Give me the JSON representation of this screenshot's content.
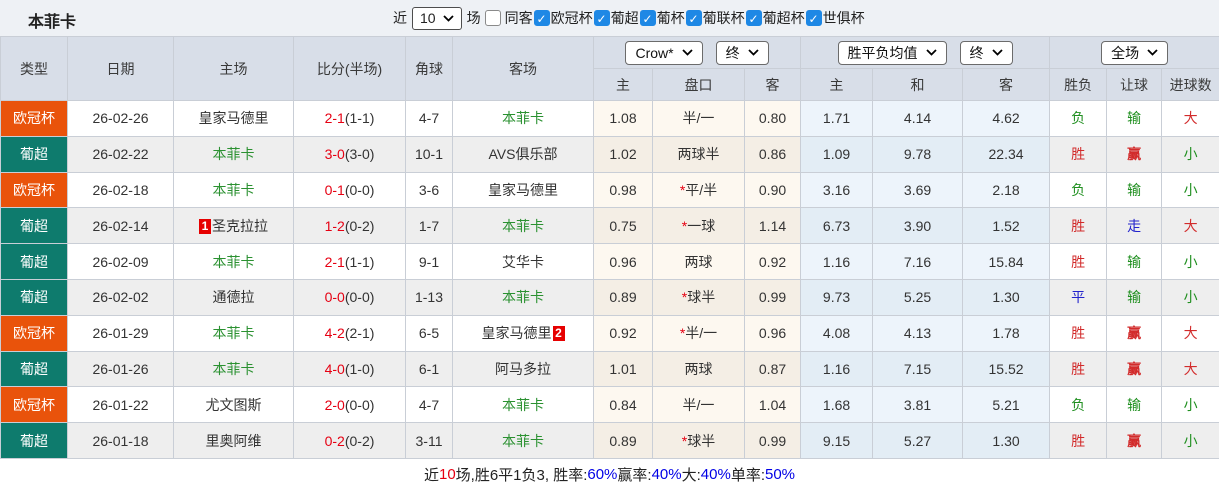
{
  "page": {
    "title": "本菲卡"
  },
  "filters": {
    "recent_prefix": "近",
    "recent_value": "10",
    "recent_suffix": "场",
    "same_opponent_label": "同客",
    "same_opponent_checked": false,
    "leagues": [
      {
        "label": "欧冠杯",
        "checked": true
      },
      {
        "label": "葡超",
        "checked": true
      },
      {
        "label": "葡杯",
        "checked": true
      },
      {
        "label": "葡联杯",
        "checked": true
      },
      {
        "label": "葡超杯",
        "checked": true
      },
      {
        "label": "世俱杯",
        "checked": true
      }
    ]
  },
  "table": {
    "columns": [
      "类型",
      "日期",
      "主场",
      "比分(半场)",
      "角球",
      "客场"
    ],
    "selects": {
      "bookmaker": "Crow*",
      "bookmaker_time": "终",
      "avg": "胜平负均值",
      "avg_time": "终",
      "scope": "全场"
    },
    "sub_headers": [
      "主",
      "盘口",
      "客",
      "主",
      "和",
      "客",
      "胜负",
      "让球",
      "进球数"
    ],
    "rows": [
      {
        "league": "欧冠杯",
        "league_color": "orange",
        "date": "26-02-26",
        "home": "皇家马德里",
        "home_green": false,
        "home_badge": "",
        "score": "2-1",
        "half": "(1-1)",
        "corners": "4-7",
        "away": "本菲卡",
        "away_green": true,
        "away_badge": "",
        "asia_home": "1.08",
        "handicap": "半/一",
        "handicap_star": false,
        "asia_away": "0.80",
        "avg_home": "1.71",
        "avg_draw": "4.14",
        "avg_away": "4.62",
        "outcome": "负",
        "outcome_color": "green",
        "let_result": "输",
        "let_color": "green",
        "goal_result": "大",
        "goal_color": "red"
      },
      {
        "league": "葡超",
        "league_color": "teal",
        "date": "26-02-22",
        "home": "本菲卡",
        "home_green": true,
        "home_badge": "",
        "score": "3-0",
        "half": "(3-0)",
        "corners": "10-1",
        "away": "AVS俱乐部",
        "away_green": false,
        "away_badge": "",
        "asia_home": "1.02",
        "handicap": "两球半",
        "handicap_star": false,
        "asia_away": "0.86",
        "avg_home": "1.09",
        "avg_draw": "9.78",
        "avg_away": "22.34",
        "outcome": "胜",
        "outcome_color": "red",
        "let_result": "赢",
        "let_color": "red",
        "goal_result": "小",
        "goal_color": "green"
      },
      {
        "league": "欧冠杯",
        "league_color": "orange",
        "date": "26-02-18",
        "home": "本菲卡",
        "home_green": true,
        "home_badge": "",
        "score": "0-1",
        "half": "(0-0)",
        "corners": "3-6",
        "away": "皇家马德里",
        "away_green": false,
        "away_badge": "",
        "asia_home": "0.98",
        "handicap": "平/半",
        "handicap_star": true,
        "asia_away": "0.90",
        "avg_home": "3.16",
        "avg_draw": "3.69",
        "avg_away": "2.18",
        "outcome": "负",
        "outcome_color": "green",
        "let_result": "输",
        "let_color": "green",
        "goal_result": "小",
        "goal_color": "green"
      },
      {
        "league": "葡超",
        "league_color": "teal",
        "date": "26-02-14",
        "home": "圣克拉拉",
        "home_green": false,
        "home_badge": "1",
        "score": "1-2",
        "half": "(0-2)",
        "corners": "1-7",
        "away": "本菲卡",
        "away_green": true,
        "away_badge": "",
        "asia_home": "0.75",
        "handicap": "一球",
        "handicap_star": true,
        "asia_away": "1.14",
        "avg_home": "6.73",
        "avg_draw": "3.90",
        "avg_away": "1.52",
        "outcome": "胜",
        "outcome_color": "red",
        "let_result": "走",
        "let_color": "blue",
        "goal_result": "大",
        "goal_color": "red"
      },
      {
        "league": "葡超",
        "league_color": "teal",
        "date": "26-02-09",
        "home": "本菲卡",
        "home_green": true,
        "home_badge": "",
        "score": "2-1",
        "half": "(1-1)",
        "corners": "9-1",
        "away": "艾华卡",
        "away_green": false,
        "away_badge": "",
        "asia_home": "0.96",
        "handicap": "两球",
        "handicap_star": false,
        "asia_away": "0.92",
        "avg_home": "1.16",
        "avg_draw": "7.16",
        "avg_away": "15.84",
        "outcome": "胜",
        "outcome_color": "red",
        "let_result": "输",
        "let_color": "green",
        "goal_result": "小",
        "goal_color": "green"
      },
      {
        "league": "葡超",
        "league_color": "teal",
        "date": "26-02-02",
        "home": "通德拉",
        "home_green": false,
        "home_badge": "",
        "score": "0-0",
        "half": "(0-0)",
        "corners": "1-13",
        "away": "本菲卡",
        "away_green": true,
        "away_badge": "",
        "asia_home": "0.89",
        "handicap": "球半",
        "handicap_star": true,
        "asia_away": "0.99",
        "avg_home": "9.73",
        "avg_draw": "5.25",
        "avg_away": "1.30",
        "outcome": "平",
        "outcome_color": "blue",
        "let_result": "输",
        "let_color": "green",
        "goal_result": "小",
        "goal_color": "green"
      },
      {
        "league": "欧冠杯",
        "league_color": "orange",
        "date": "26-01-29",
        "home": "本菲卡",
        "home_green": true,
        "home_badge": "",
        "score": "4-2",
        "half": "(2-1)",
        "corners": "6-5",
        "away": "皇家马德里",
        "away_green": false,
        "away_badge": "2",
        "asia_home": "0.92",
        "handicap": "半/一",
        "handicap_star": true,
        "asia_away": "0.96",
        "avg_home": "4.08",
        "avg_draw": "4.13",
        "avg_away": "1.78",
        "outcome": "胜",
        "outcome_color": "red",
        "let_result": "赢",
        "let_color": "red",
        "goal_result": "大",
        "goal_color": "red"
      },
      {
        "league": "葡超",
        "league_color": "teal",
        "date": "26-01-26",
        "home": "本菲卡",
        "home_green": true,
        "home_badge": "",
        "score": "4-0",
        "half": "(1-0)",
        "corners": "6-1",
        "away": "阿马多拉",
        "away_green": false,
        "away_badge": "",
        "asia_home": "1.01",
        "handicap": "两球",
        "handicap_star": false,
        "asia_away": "0.87",
        "avg_home": "1.16",
        "avg_draw": "7.15",
        "avg_away": "15.52",
        "outcome": "胜",
        "outcome_color": "red",
        "let_result": "赢",
        "let_color": "red",
        "goal_result": "大",
        "goal_color": "red"
      },
      {
        "league": "欧冠杯",
        "league_color": "orange",
        "date": "26-01-22",
        "home": "尤文图斯",
        "home_green": false,
        "home_badge": "",
        "score": "2-0",
        "half": "(0-0)",
        "corners": "4-7",
        "away": "本菲卡",
        "away_green": true,
        "away_badge": "",
        "asia_home": "0.84",
        "handicap": "半/一",
        "handicap_star": false,
        "asia_away": "1.04",
        "avg_home": "1.68",
        "avg_draw": "3.81",
        "avg_away": "5.21",
        "outcome": "负",
        "outcome_color": "green",
        "let_result": "输",
        "let_color": "green",
        "goal_result": "小",
        "goal_color": "green"
      },
      {
        "league": "葡超",
        "league_color": "teal",
        "date": "26-01-18",
        "home": "里奥阿维",
        "home_green": false,
        "home_badge": "",
        "score": "0-2",
        "half": "(0-2)",
        "corners": "3-11",
        "away": "本菲卡",
        "away_green": true,
        "away_badge": "",
        "asia_home": "0.89",
        "handicap": "球半",
        "handicap_star": true,
        "asia_away": "0.99",
        "avg_home": "9.15",
        "avg_draw": "5.27",
        "avg_away": "1.30",
        "outcome": "胜",
        "outcome_color": "red",
        "let_result": "赢",
        "let_color": "red",
        "goal_result": "小",
        "goal_color": "green"
      }
    ]
  },
  "footer": {
    "segments": [
      {
        "text": "近",
        "color": "dark"
      },
      {
        "text": "10",
        "color": "red"
      },
      {
        "text": "场,胜6平1负3, 胜率:",
        "color": "dark"
      },
      {
        "text": "60%",
        "color": "blue"
      },
      {
        "text": " 赢率:",
        "color": "dark"
      },
      {
        "text": "40%",
        "color": "blue"
      },
      {
        "text": " 大:",
        "color": "dark"
      },
      {
        "text": "40%",
        "color": "blue"
      },
      {
        "text": " 单率:",
        "color": "dark"
      },
      {
        "text": "50%",
        "color": "blue"
      }
    ]
  },
  "colors": {
    "league_orange": "#e9530b",
    "league_teal": "#0e7b6d",
    "score_red": "#e60012",
    "benfica_green": "#2b9131",
    "result_red": "#d22b2b",
    "result_green": "#1f8f1f",
    "result_blue": "#2323cc",
    "footer_blue": "#0000e6",
    "checkbox_blue": "#1e88e5",
    "header_bg": "#d8dee8"
  }
}
